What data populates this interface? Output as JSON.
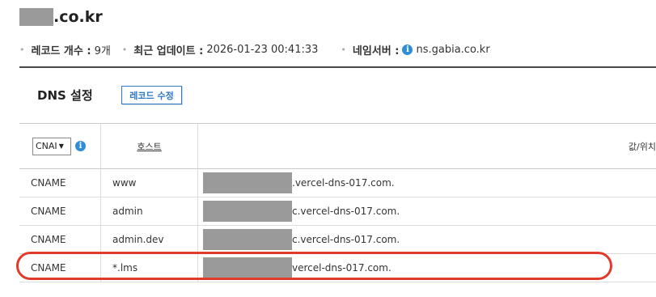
{
  "header": {
    "domain_suffix": ".co.kr"
  },
  "meta": {
    "record_count_label": "레코드 개수 :",
    "record_count_value": "9개",
    "updated_label": "최근 업데이트 :",
    "updated_value": "2026-01-23 00:41:33",
    "nameserver_label": "네임서버 :",
    "nameserver_value": "ns.gabia.co.kr",
    "bullet": "•"
  },
  "dns": {
    "title": "DNS 설정",
    "edit_button": "레코드 수정"
  },
  "table": {
    "type_filter": "CNAI",
    "host_header": "호스트",
    "value_header": "값/위치",
    "rows": [
      {
        "type": "CNAME",
        "host": "www",
        "value": ".vercel-dns-017.com."
      },
      {
        "type": "CNAME",
        "host": "admin",
        "value": "c.vercel-dns-017.com."
      },
      {
        "type": "CNAME",
        "host": "admin.dev",
        "value": "c.vercel-dns-017.com."
      },
      {
        "type": "CNAME",
        "host": "*.lms",
        "value": "vercel-dns-017.com."
      }
    ]
  },
  "icons": {
    "info": "i",
    "select_arrow": "▼"
  },
  "colors": {
    "highlight": "#e23a2a",
    "accent": "#2e78c4",
    "info": "#2e8ed8",
    "redaction": "#9a9a9a"
  }
}
